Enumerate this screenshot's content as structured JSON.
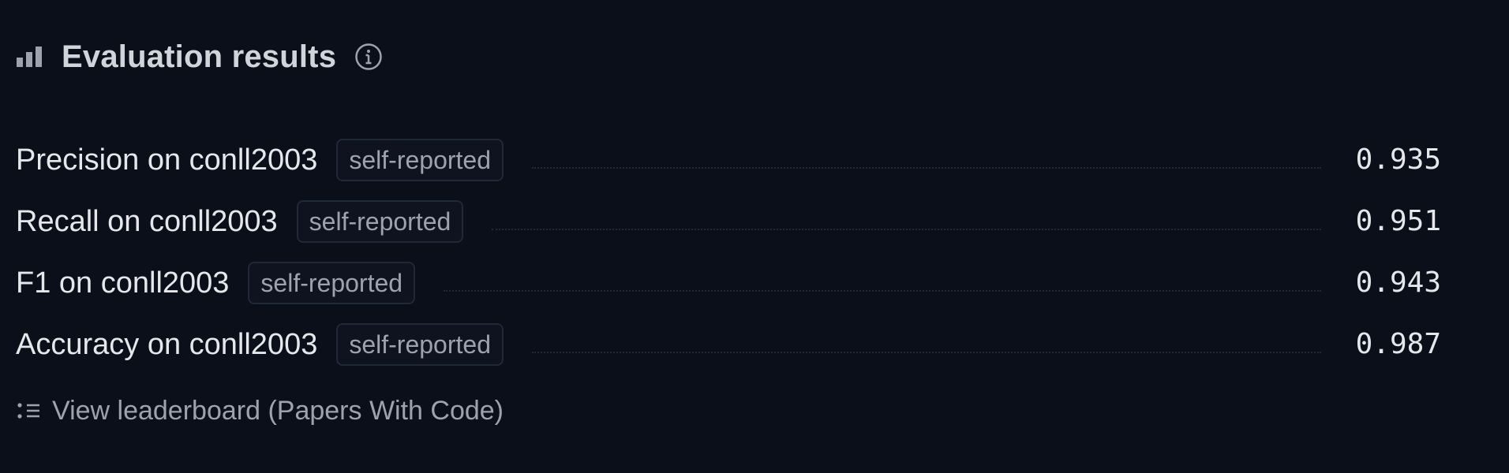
{
  "header": {
    "title": "Evaluation results",
    "icon": "bar-chart-icon",
    "info_icon": "info-icon"
  },
  "results": [
    {
      "metric": "Precision on conll2003",
      "badge": "self-reported",
      "value": "0.935"
    },
    {
      "metric": "Recall on conll2003",
      "badge": "self-reported",
      "value": "0.951"
    },
    {
      "metric": "F1 on conll2003",
      "badge": "self-reported",
      "value": "0.943"
    },
    {
      "metric": "Accuracy on conll2003",
      "badge": "self-reported",
      "value": "0.987"
    }
  ],
  "leaderboard": {
    "label": "View leaderboard (Papers With Code)",
    "icon": "list-icon"
  },
  "colors": {
    "background": "#0b0f19",
    "text": "#e5e7eb",
    "muted": "#9ca3af",
    "border": "#1f2937"
  }
}
